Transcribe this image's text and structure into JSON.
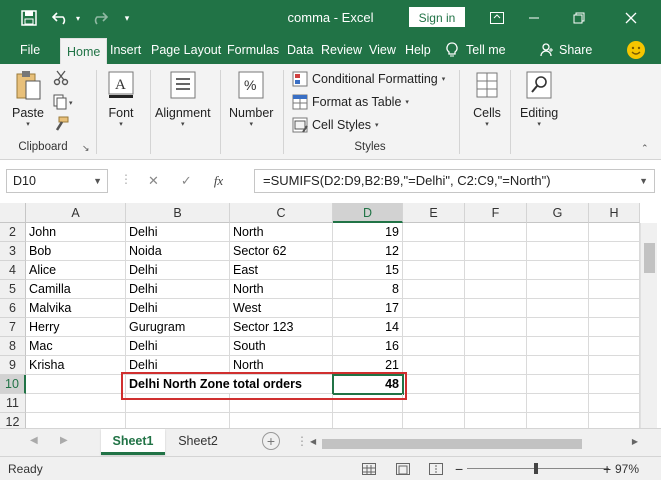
{
  "titlebar": {
    "title": "comma  -  Excel",
    "signin_label": "Sign in"
  },
  "tabs": [
    "File",
    "Home",
    "Insert",
    "Page Layout",
    "Formulas",
    "Data",
    "Review",
    "View",
    "Help"
  ],
  "active_tab": "Home",
  "tell_me": "Tell me",
  "share": "Share",
  "ribbon": {
    "clipboard": {
      "paste": "Paste",
      "group_label": "Clipboard"
    },
    "font": "Font",
    "alignment": "Alignment",
    "number": "Number",
    "styles": {
      "conditional_formatting": "Conditional Formatting",
      "format_as_table": "Format as Table",
      "cell_styles": "Cell Styles",
      "group_label": "Styles"
    },
    "cells": "Cells",
    "editing": "Editing"
  },
  "formula_bar": {
    "name_box": "D10",
    "fx": "fx",
    "formula": "=SUMIFS(D2:D9,B2:B9,\"=Delhi\", C2:C9,\"=North\")"
  },
  "grid": {
    "columns": [
      "A",
      "B",
      "C",
      "D",
      "E",
      "F",
      "G",
      "H"
    ],
    "selected_column": "D",
    "selected_row": "10",
    "rows": [
      {
        "n": "2",
        "a": "John",
        "b": "Delhi",
        "c": "North",
        "d": "19"
      },
      {
        "n": "3",
        "a": "Bob",
        "b": "Noida",
        "c": "Sector 62",
        "d": "12"
      },
      {
        "n": "4",
        "a": "Alice",
        "b": "Delhi",
        "c": "East",
        "d": "15"
      },
      {
        "n": "5",
        "a": "Camilla",
        "b": "Delhi",
        "c": "North",
        "d": "8"
      },
      {
        "n": "6",
        "a": "Malvika",
        "b": "Delhi",
        "c": "West",
        "d": "17"
      },
      {
        "n": "7",
        "a": "Herry",
        "b": "Gurugram",
        "c": "Sector 123",
        "d": "14"
      },
      {
        "n": "8",
        "a": "Mac",
        "b": "Delhi",
        "c": "South",
        "d": "16"
      },
      {
        "n": "9",
        "a": "Krisha",
        "b": "Delhi",
        "c": "North",
        "d": "21"
      },
      {
        "n": "10",
        "a": "",
        "b": "Delhi North Zone total orders",
        "c": "",
        "d": "48"
      },
      {
        "n": "11",
        "a": "",
        "b": "",
        "c": "",
        "d": ""
      },
      {
        "n": "12",
        "a": "",
        "b": "",
        "c": "",
        "d": ""
      }
    ]
  },
  "sheets": [
    "Sheet1",
    "Sheet2"
  ],
  "active_sheet": "Sheet1",
  "status": {
    "ready": "Ready",
    "zoom": "97%",
    "zoom_minus": "−",
    "zoom_plus": "+"
  },
  "colors": {
    "excel_green": "#217346",
    "highlight_red": "#d02f2f"
  }
}
